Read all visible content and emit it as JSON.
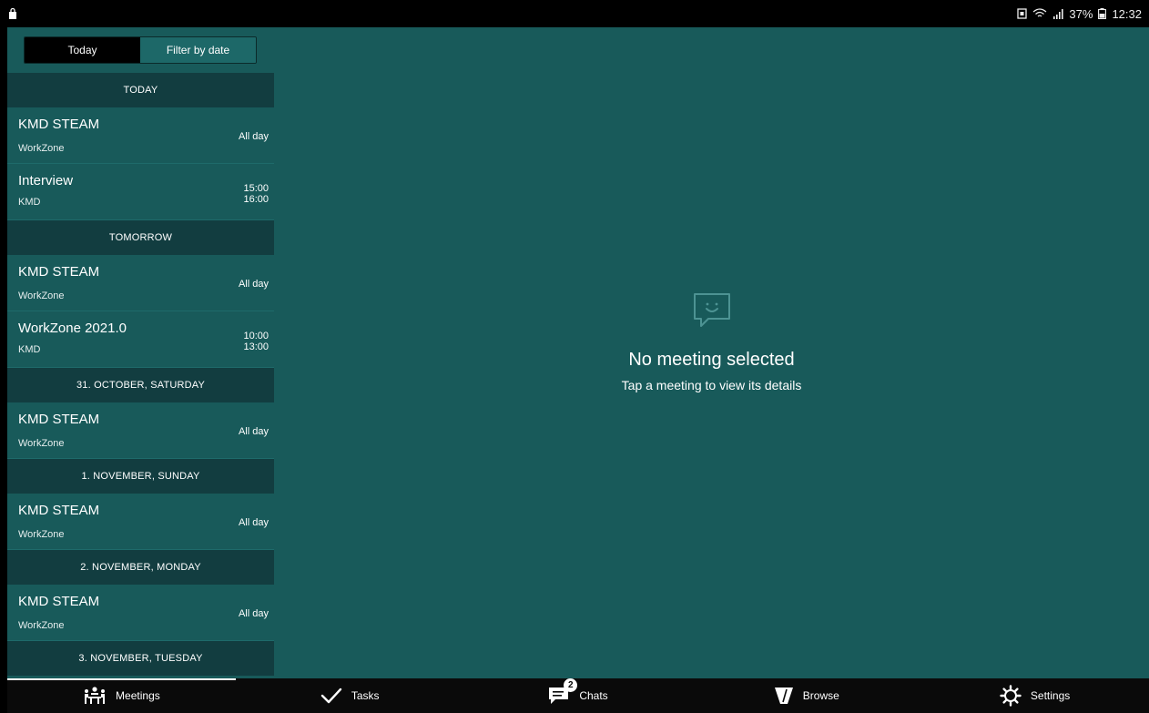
{
  "statusbar": {
    "battery_percent": "37%",
    "time": "12:32"
  },
  "sidebar": {
    "segment": {
      "today_label": "Today",
      "filter_label": "Filter by date"
    },
    "sections": [
      {
        "header": "TODAY",
        "meetings": [
          {
            "title": "KMD STEAM",
            "subtitle": "WorkZone",
            "time": "All day"
          },
          {
            "title": "Interview",
            "subtitle": "KMD",
            "start": "15:00",
            "end": "16:00"
          }
        ]
      },
      {
        "header": "TOMORROW",
        "meetings": [
          {
            "title": "KMD STEAM",
            "subtitle": "WorkZone",
            "time": "All day"
          },
          {
            "title": "WorkZone 2021.0",
            "subtitle": "KMD",
            "start": "10:00",
            "end": "13:00"
          }
        ]
      },
      {
        "header": "31. OCTOBER, SATURDAY",
        "meetings": [
          {
            "title": "KMD STEAM",
            "subtitle": "WorkZone",
            "time": "All day"
          }
        ]
      },
      {
        "header": "1. NOVEMBER, SUNDAY",
        "meetings": [
          {
            "title": "KMD STEAM",
            "subtitle": "WorkZone",
            "time": "All day"
          }
        ]
      },
      {
        "header": "2. NOVEMBER, MONDAY",
        "meetings": [
          {
            "title": "KMD STEAM",
            "subtitle": "WorkZone",
            "time": "All day"
          }
        ]
      },
      {
        "header": "3. NOVEMBER, TUESDAY",
        "meetings": []
      }
    ]
  },
  "main": {
    "empty_title": "No meeting selected",
    "empty_subtitle": "Tap a meeting to view its details"
  },
  "bottomnav": {
    "meetings": "Meetings",
    "tasks": "Tasks",
    "chats": "Chats",
    "chats_badge": "2",
    "browse": "Browse",
    "settings": "Settings"
  },
  "colors": {
    "panel": "#185a5a",
    "section_header": "#123d40",
    "nav": "#0a0a0a"
  }
}
